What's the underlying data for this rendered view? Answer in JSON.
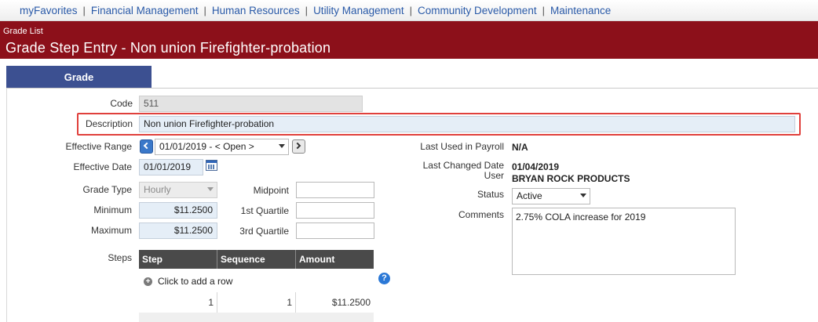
{
  "nav": {
    "items": [
      "myFavorites",
      "Financial Management",
      "Human Resources",
      "Utility Management",
      "Community Development",
      "Maintenance"
    ],
    "separator": "|"
  },
  "banner": {
    "breadcrumb": "Grade List",
    "title": "Grade Step Entry - Non union Firefighter-probation"
  },
  "tab": {
    "label": "Grade"
  },
  "form": {
    "code_label": "Code",
    "code_value": "511",
    "description_label": "Description",
    "description_value": "Non union Firefighter-probation",
    "effective_range_label": "Effective Range",
    "effective_range_value": "01/01/2019 - < Open >",
    "effective_date_label": "Effective Date",
    "effective_date_value": "01/01/2019",
    "grade_type_label": "Grade Type",
    "grade_type_value": "Hourly",
    "minimum_label": "Minimum",
    "minimum_value": "$11.2500",
    "maximum_label": "Maximum",
    "maximum_value": "$11.2500",
    "midpoint_label": "Midpoint",
    "midpoint_value": "",
    "q1_label": "1st Quartile",
    "q1_value": "",
    "q3_label": "3rd Quartile",
    "q3_value": "",
    "steps_label": "Steps"
  },
  "right": {
    "last_used_label": "Last Used in Payroll",
    "last_used_value": "N/A",
    "last_changed_date_label": "Last Changed Date",
    "last_changed_date_value": "01/04/2019",
    "user_label": "User",
    "user_value": "BRYAN ROCK PRODUCTS",
    "status_label": "Status",
    "status_value": "Active",
    "comments_label": "Comments",
    "comments_value": "2.75% COLA increase for 2019"
  },
  "steps_grid": {
    "columns": [
      "Step",
      "Sequence",
      "Amount"
    ],
    "add_row_label": "Click to add a row",
    "rows": [
      {
        "step": "1",
        "sequence": "1",
        "amount": "$11.2500"
      }
    ]
  },
  "icons": {
    "help": "help-icon",
    "calendar": "calendar-icon",
    "prev": "chevron-left-icon",
    "next": "chevron-right-icon",
    "add": "add-circle-icon"
  },
  "colors": {
    "banner": "#8c101a",
    "tab": "#3c5091",
    "link": "#2a5aa8",
    "highlight": "#e0403c"
  }
}
